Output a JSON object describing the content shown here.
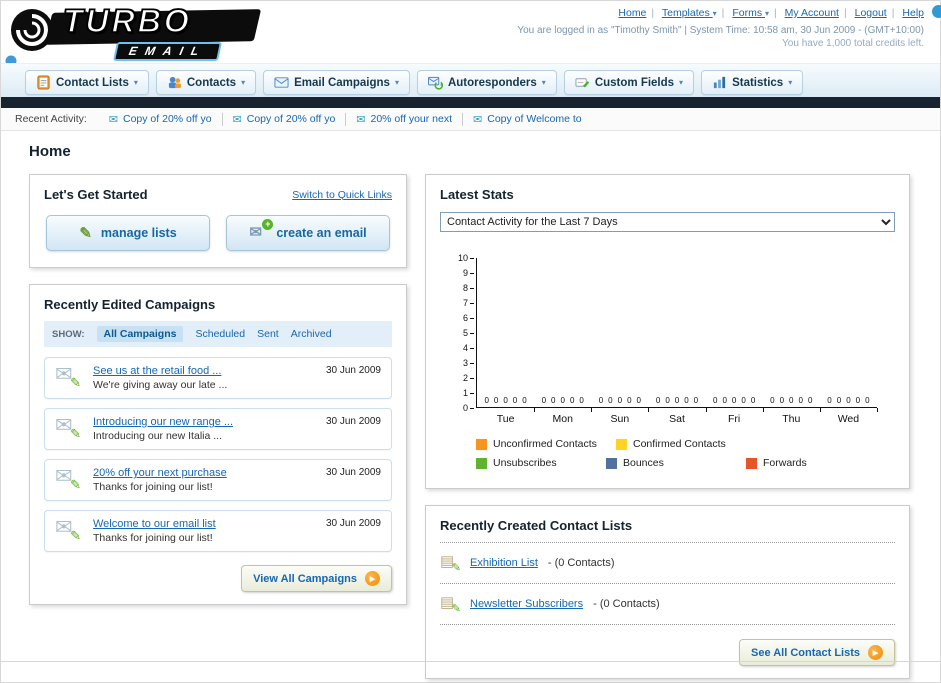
{
  "icons": {
    "dropdown_arrow": "▾",
    "envelope": "✉",
    "pencil": "✎",
    "plus": "+",
    "arrow_right": "▶",
    "note": "▤"
  },
  "header": {
    "logo_text": "TURBO",
    "logo_sub": "EMAIL",
    "nav": {
      "home": "Home",
      "templates": "Templates",
      "forms": "Forms",
      "my_account": "My Account",
      "logout": "Logout",
      "help": "Help"
    },
    "login_info": "You are logged in as \"Timothy Smith\" | System Time: 10:58 am, 30 Jun 2009 - (GMT+10:00)",
    "credits_info": "You have 1,000 total credits left."
  },
  "main_nav": {
    "tabs": [
      {
        "label": "Contact Lists"
      },
      {
        "label": "Contacts"
      },
      {
        "label": "Email Campaigns"
      },
      {
        "label": "Autoresponders"
      },
      {
        "label": "Custom Fields"
      },
      {
        "label": "Statistics"
      }
    ]
  },
  "recent_activity": {
    "label": "Recent Activity:",
    "items": [
      {
        "text": "Copy of 20% off yo"
      },
      {
        "text": "Copy of 20% off yo"
      },
      {
        "text": "20% off your next"
      },
      {
        "text": "Copy of Welcome to"
      }
    ]
  },
  "page": {
    "title": "Home"
  },
  "get_started": {
    "title": "Let's Get Started",
    "switch_link": "Switch to Quick Links",
    "manage_lists": "manage lists",
    "create_email": "create an email"
  },
  "campaigns": {
    "title": "Recently Edited Campaigns",
    "show_label": "SHOW:",
    "filters": [
      {
        "label": "All Campaigns"
      },
      {
        "label": "Scheduled"
      },
      {
        "label": "Sent"
      },
      {
        "label": "Archived"
      }
    ],
    "items": [
      {
        "title": "See us at the retail food ...",
        "subtitle": "We're giving away our late ...",
        "date": "30 Jun 2009"
      },
      {
        "title": "Introducing our new range ...",
        "subtitle": "Introducing our new Italia ...",
        "date": "30 Jun 2009"
      },
      {
        "title": "20% off your next purchase",
        "subtitle": "Thanks for joining our list!",
        "date": "30 Jun 2009"
      },
      {
        "title": "Welcome to our email list",
        "subtitle": "Thanks for joining our list!",
        "date": "30 Jun 2009"
      }
    ],
    "view_all": "View All Campaigns"
  },
  "stats": {
    "title": "Latest Stats",
    "period_selected": "Contact Activity for the Last 7 Days",
    "chart_data": {
      "type": "bar",
      "title": "Contact Activity for the Last 7 Days",
      "categories": [
        "Tue",
        "Mon",
        "Sun",
        "Sat",
        "Fri",
        "Thu",
        "Wed"
      ],
      "series": [
        {
          "name": "Unconfirmed Contacts",
          "color": "#f7941d",
          "values": [
            0,
            0,
            0,
            0,
            0,
            0,
            0
          ]
        },
        {
          "name": "Confirmed Contacts",
          "color": "#ffd226",
          "values": [
            0,
            0,
            0,
            0,
            0,
            0,
            0
          ]
        },
        {
          "name": "Unsubscribes",
          "color": "#61b22f",
          "values": [
            0,
            0,
            0,
            0,
            0,
            0,
            0
          ]
        },
        {
          "name": "Bounces",
          "color": "#5470a0",
          "values": [
            0,
            0,
            0,
            0,
            0,
            0,
            0
          ]
        },
        {
          "name": "Forwards",
          "color": "#e8542a",
          "values": [
            0,
            0,
            0,
            0,
            0,
            0,
            0
          ]
        }
      ],
      "ylim": [
        0,
        10
      ],
      "y_ticks": [
        0,
        1,
        2,
        3,
        4,
        5,
        6,
        7,
        8,
        9,
        10
      ],
      "xlabel": "",
      "ylabel": "",
      "grid": false,
      "legend_position": "bottom"
    }
  },
  "contact_lists": {
    "title": "Recently Created Contact Lists",
    "items": [
      {
        "name": "Exhibition List",
        "detail": " - (0 Contacts)"
      },
      {
        "name": "Newsletter Subscribers",
        "detail": " - (0 Contacts)"
      }
    ],
    "see_all": "See All Contact Lists"
  }
}
